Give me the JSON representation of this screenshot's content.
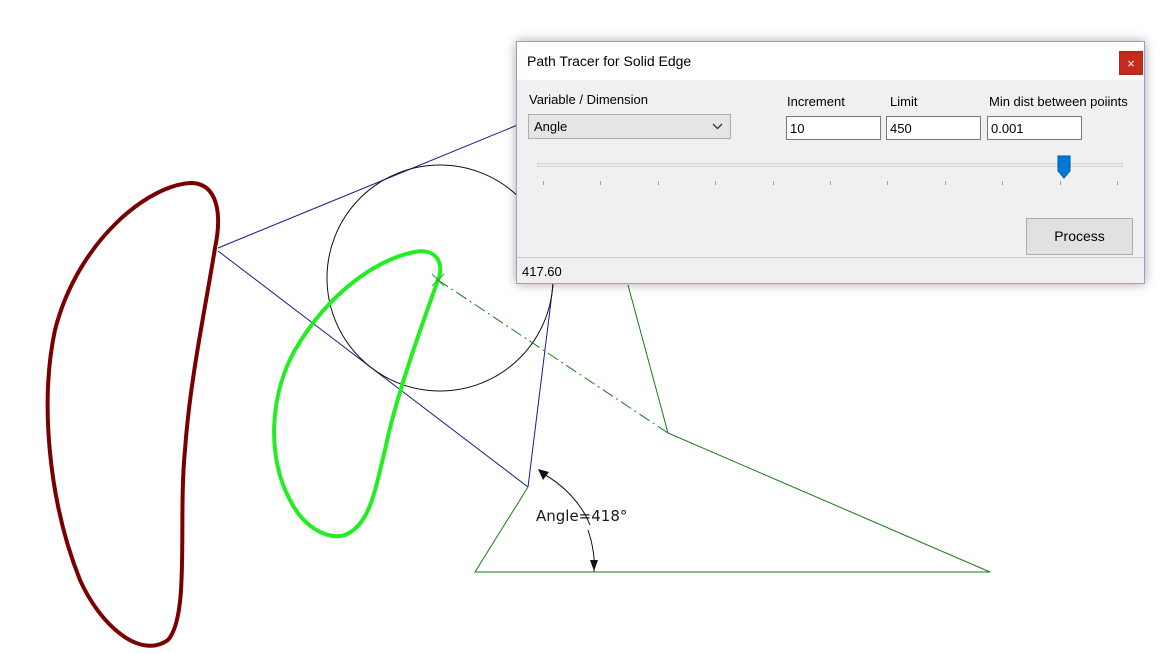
{
  "drawing": {
    "dimension_label": "Angle=418°"
  },
  "dialog": {
    "title": "Path Tracer for Solid Edge",
    "close_glyph": "×",
    "variable_label": "Variable / Dimension",
    "variable_value": "Angle",
    "increment_label": "Increment",
    "increment_value": "10",
    "limit_label": "Limit",
    "limit_value": "450",
    "min_dist_label": "Min dist between poiints",
    "min_dist_value": "0.001",
    "slider_value_fraction": 0.9,
    "process_label": "Process",
    "status_value": "417.60"
  },
  "colors": {
    "dark_red_path": "#7a0000",
    "green_path": "#22ee22",
    "construction_blue": "#1a1a8c",
    "triangle_green": "#1a7a1a",
    "close_button": "#c42b1c",
    "slider_thumb": "#0078d7"
  }
}
